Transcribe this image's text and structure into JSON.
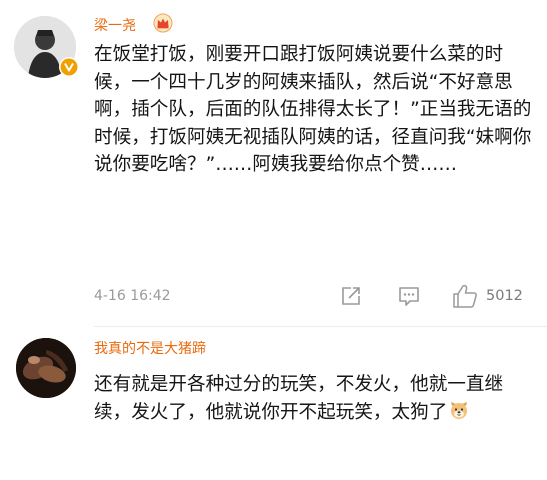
{
  "comments": [
    {
      "username": "梁一尧",
      "avatar": "person-silhouette-avatar",
      "verified_badge": "verified-v-badge",
      "crown_badge": "crown-icon",
      "text": "在饭堂打饭，刚要开口跟打饭阿姨说要什么菜的时候，一个四十几岁的阿姨来插队，然后说“不好意思啊，插个队，后面的队伍排得太长了！”正当我无语的时候，打饭阿姨无视插队阿姨的话，径直问我“妹啊你说你要吃啥？”……阿姨我要给你点个赞……",
      "time": "4-16 16:42",
      "actions": {
        "share_icon": "share-icon",
        "reply_icon": "comment-icon",
        "like_icon": "thumbs-up-icon",
        "like_count": "5012"
      }
    },
    {
      "username": "我真的不是大猪蹄",
      "avatar": "dark-photo-avatar",
      "text": "还有就是开各种过分的玩笑，不发火，他就一直继续，发火了，他就说你开不起玩笑，太狗了",
      "emoji": "dog-face-emoji"
    }
  ],
  "colors": {
    "username": "#e86b0f",
    "verified": "#f0a000",
    "text": "#151515",
    "meta": "#9a9a9a",
    "icon": "#9a9a9a"
  }
}
